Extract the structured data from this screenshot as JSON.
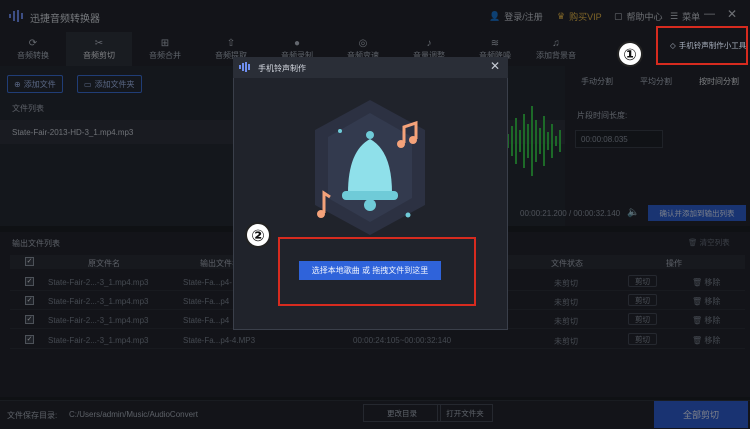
{
  "app": {
    "title": "迅捷音频转换器",
    "login": "登录/注册",
    "vip": "购买VIP",
    "help": "帮助中心",
    "menu": "菜单",
    "minimize": "—",
    "close": "✕"
  },
  "nav": {
    "tabs": [
      {
        "label": "音频转换",
        "icon": "⟳"
      },
      {
        "label": "音频剪切",
        "icon": "✂"
      },
      {
        "label": "音频合并",
        "icon": "⊞"
      },
      {
        "label": "音频提取",
        "icon": "⇧"
      },
      {
        "label": "音频录制",
        "icon": "●"
      },
      {
        "label": "音频变速",
        "icon": "◎"
      },
      {
        "label": "音量调整",
        "icon": "♪"
      },
      {
        "label": "音频降噪",
        "icon": "≋"
      },
      {
        "label": "添加背景音",
        "icon": "♫"
      }
    ]
  },
  "left": {
    "add_file": "添加文件",
    "add_folder": "添加文件夹",
    "file_list_label": "文件列表",
    "file_name": "State-Fair-2013-HD-3_1.mp4.mp3"
  },
  "split": {
    "tabs": [
      "手动分割",
      "平均分割",
      "按时间分割"
    ],
    "length_label": "片段时间长度:",
    "length_value": "00:00:08.035",
    "current_time": "00:00:21.200",
    "separator": "/",
    "total_time": "00:00:32.140",
    "confirm_button": "确认并添加到输出列表"
  },
  "output": {
    "label": "输出文件列表",
    "clear_label": "清空列表",
    "columns": [
      "原文件名",
      "输出文件名",
      "文件状态",
      "操作"
    ],
    "rows": [
      {
        "src": "State-Fair-2...-3_1.mp4.mp3",
        "dst": "State-Fa...p4-",
        "range": "",
        "status": "未剪切"
      },
      {
        "src": "State-Fair-2...-3_1.mp4.mp3",
        "dst": "State-Fa...p4",
        "range": "",
        "status": "未剪切"
      },
      {
        "src": "State-Fair-2...-3_1.mp4.mp3",
        "dst": "State-Fa...p4",
        "range": "",
        "status": "未剪切"
      },
      {
        "src": "State-Fair-2...-3_1.mp4.mp3",
        "dst": "State-Fa...p4-4.MP3",
        "range": "00:00:24:105~00:00:32:140",
        "status": "未剪切"
      }
    ],
    "cut_label": "剪切",
    "remove_label": "移除"
  },
  "bottom": {
    "save_dir_label": "文件保存目录:",
    "save_dir_path": "C:/Users/admin/Music/AudioConvert",
    "change_dir": "更改目录",
    "open_folder": "打开文件夹",
    "convert_all": "全部剪切"
  },
  "dialog": {
    "title": "手机铃声制作",
    "close": "✕",
    "select_button": "选择本地歌曲 或 拖拽文件到这里"
  },
  "annotations": {
    "box1_label": "手机铃声制作小工具",
    "marker1": "①",
    "marker2": "②",
    "color": "#d72b1f"
  },
  "colors": {
    "accent": "#2f63da",
    "background": "#1c1f26"
  }
}
